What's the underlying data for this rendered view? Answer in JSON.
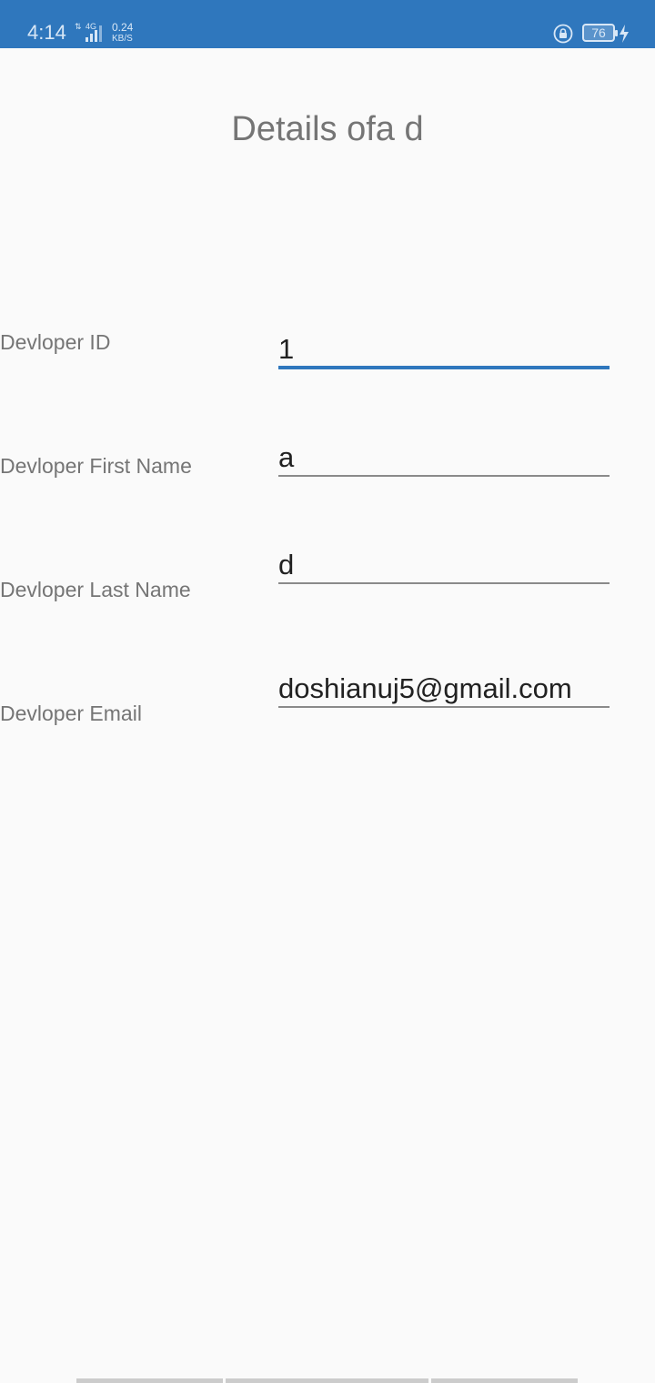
{
  "status_bar": {
    "time": "4:14",
    "network_type": "4G",
    "net_speed_value": "0.24",
    "net_speed_unit": "KB/S",
    "battery_level": "76",
    "icons": [
      "data-transfer-icon",
      "signal-icon",
      "rotation-lock-icon",
      "battery-icon",
      "charging-bolt-icon"
    ],
    "background_color": "#2f77bd"
  },
  "page": {
    "title": "Details ofa d",
    "accent_color": "#2f77bd"
  },
  "form": {
    "fields": [
      {
        "label": "Devloper ID",
        "value": "1"
      },
      {
        "label": "Devloper First Name",
        "value": "a"
      },
      {
        "label": "Devloper Last Name",
        "value": "d"
      },
      {
        "label": "Devloper Email",
        "value": "doshianuj5@gmail.com"
      }
    ]
  }
}
